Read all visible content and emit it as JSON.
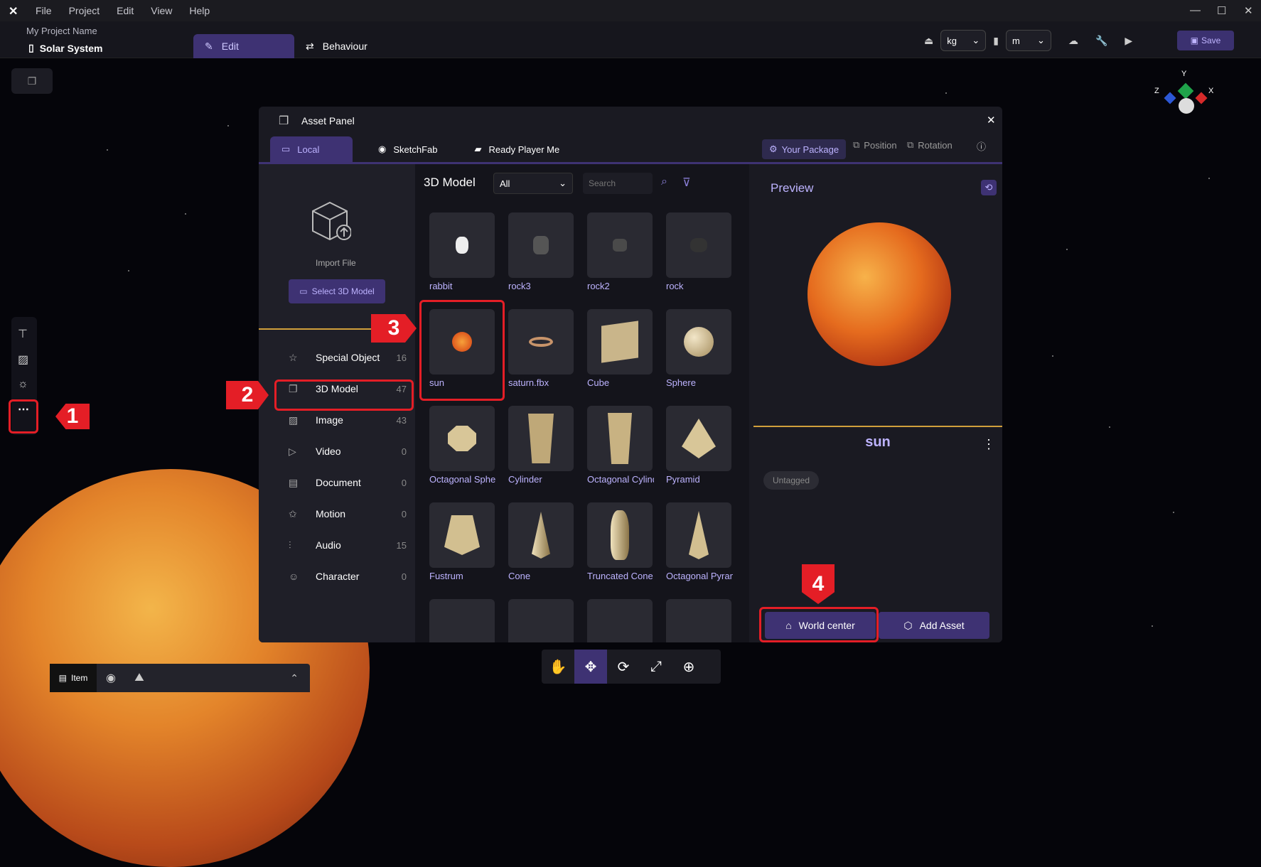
{
  "menu": [
    "File",
    "Project",
    "Edit",
    "View",
    "Help"
  ],
  "header": {
    "project_name": "My Project Name",
    "scene_name": "Solar System",
    "tab_edit": "Edit",
    "tab_behaviour": "Behaviour",
    "mass_unit": "kg",
    "length_unit": "m",
    "save": "Save"
  },
  "gizmo": {
    "y": "Y",
    "x": "X",
    "z": "Z"
  },
  "panel": {
    "title": "Asset Panel",
    "tabs": [
      "Local",
      "SketchFab",
      "Ready Player Me"
    ],
    "your_package": "Your Package",
    "position": "Position",
    "rotation": "Rotation",
    "import_label": "Import File",
    "select_button": "Select 3D Model",
    "categories": [
      {
        "label": "Special Object",
        "count": "16"
      },
      {
        "label": "3D Model",
        "count": "47"
      },
      {
        "label": "Image",
        "count": "43"
      },
      {
        "label": "Video",
        "count": "0"
      },
      {
        "label": "Document",
        "count": "0"
      },
      {
        "label": "Motion",
        "count": "0"
      },
      {
        "label": "Audio",
        "count": "15"
      },
      {
        "label": "Character",
        "count": "0"
      }
    ],
    "grid_title": "3D Model",
    "filter_value": "All",
    "search_placeholder": "Search",
    "models": [
      "rabbit",
      "rock3",
      "rock2",
      "rock",
      "sun",
      "saturn.fbx",
      "Cube",
      "Sphere",
      "Octagonal Sphere",
      "Cylinder",
      "Octagonal Cylinder",
      "Pyramid",
      "Fustrum",
      "Cone",
      "Truncated Cone",
      "Octagonal Pyramid"
    ],
    "preview_title": "Preview",
    "preview_name": "sun",
    "tag": "Untagged",
    "world_center": "World center",
    "add_asset": "Add Asset"
  },
  "callouts": [
    "1",
    "2",
    "3",
    "4"
  ],
  "bottom": {
    "item_tab": "Item"
  },
  "colors": {
    "accent": "#3e3273",
    "highlight": "#e41e26",
    "gold": "#d1a03c"
  }
}
